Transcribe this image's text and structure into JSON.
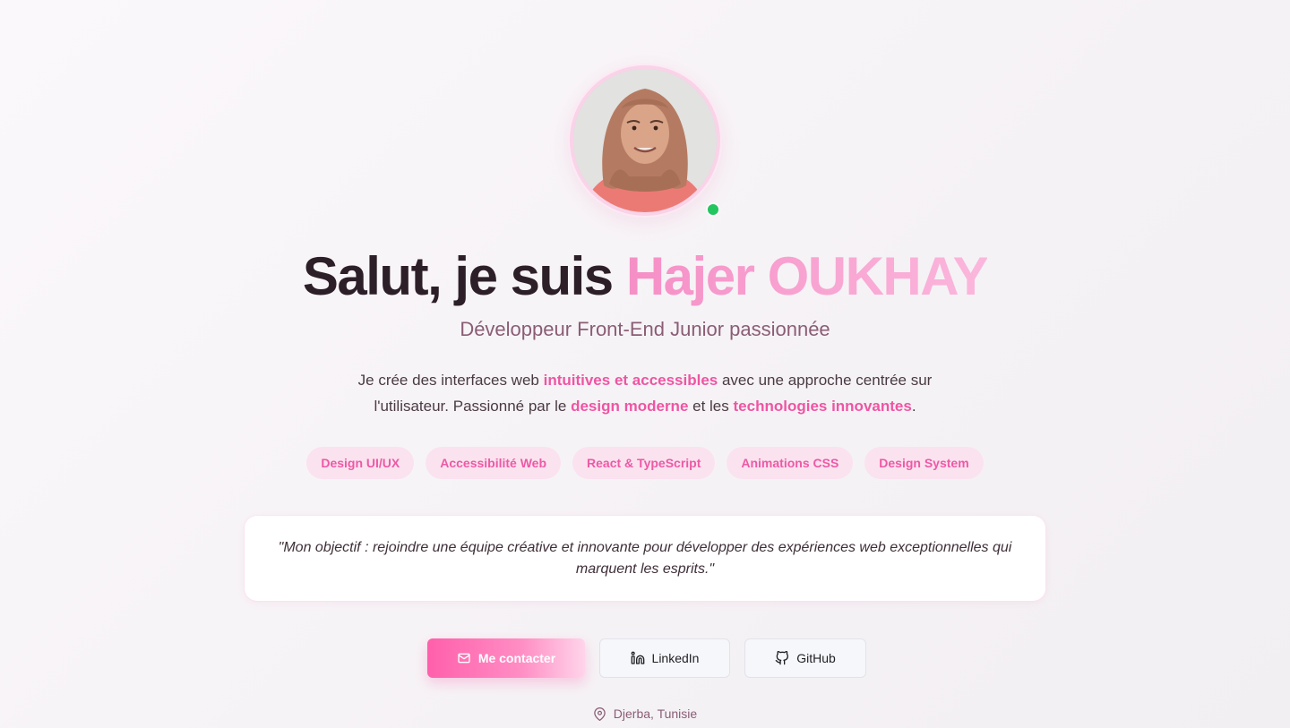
{
  "profile": {
    "photo_alt": "Hajer OUKHAY",
    "status_color": "#22c55e"
  },
  "hero": {
    "greeting": "Salut, je suis ",
    "name": "Hajer OUKHAY",
    "subtitle": "Développeur Front-End Junior passionnée",
    "intro": {
      "part1": "Je crée des interfaces web ",
      "hl1": "intuitives et accessibles",
      "part2": " avec une approche centrée sur l'utilisateur. Passionné par le ",
      "hl2": "design moderne",
      "part3": " et les ",
      "hl3": "technologies innovantes",
      "part4": "."
    }
  },
  "tags": [
    "Design UI/UX",
    "Accessibilité Web",
    "React & TypeScript",
    "Animations CSS",
    "Design System"
  ],
  "quote": "\"Mon objectif : rejoindre une équipe créative et innovante pour développer des expériences web exceptionnelles qui marquent les esprits.\"",
  "actions": {
    "contact": {
      "label": "Me contacter",
      "icon": "mail-icon"
    },
    "linkedin": {
      "label": "LinkedIn",
      "icon": "linkedin-icon"
    },
    "github": {
      "label": "GitHub",
      "icon": "github-icon"
    }
  },
  "location": {
    "label": "Djerba, Tunisie",
    "icon": "map-pin-icon"
  },
  "colors": {
    "accent": "#ee55a3",
    "tag_bg": "#fbe2ef",
    "heading": "#2d1f28",
    "subtitle": "#8a5d75"
  }
}
